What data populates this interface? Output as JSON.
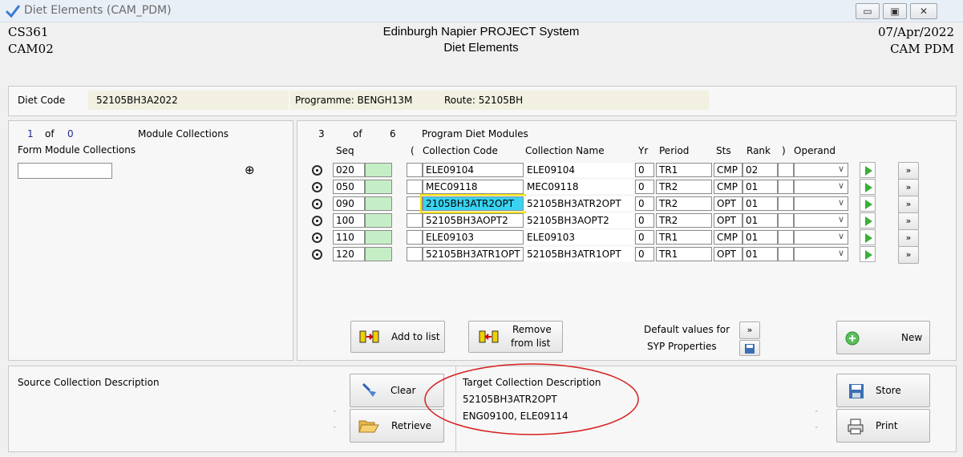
{
  "window": {
    "title": "Diet Elements (CAM_PDM)",
    "btn_min": "▭",
    "btn_max": "▣",
    "btn_close": "✕"
  },
  "header": {
    "left1": "CS361",
    "left2": "CAM02",
    "center1": "Edinburgh Napier PROJECT System",
    "center2": "Diet Elements",
    "right1": "07/Apr/2022",
    "right2": "CAM  PDM"
  },
  "diet": {
    "code_label": "Diet Code",
    "code_value": "52105BH3A2022",
    "programme": "Programme: BENGH13M",
    "route": "Route: 52105BH"
  },
  "left_panel": {
    "count": "1",
    "of": "of",
    "total": "0",
    "title": "Module Collections",
    "form_label": "Form Module Collections",
    "input_value": "",
    "target_icon": "⊕"
  },
  "grid": {
    "count": "3",
    "of": "of",
    "total": "6",
    "title": "Program Diet Modules",
    "headers": {
      "seq": "Seq",
      "lparen": "(",
      "code": "Collection Code",
      "name": "Collection Name",
      "yr": "Yr",
      "period": "Period",
      "sts": "Sts",
      "rank": "Rank",
      "rparen": ")",
      "operand": "Operand"
    },
    "rows": [
      {
        "seq": "020",
        "code": "ELE09104",
        "name": "ELE09104",
        "yr": "0",
        "period": "TR1",
        "sts": "CMP",
        "rank": "02"
      },
      {
        "seq": "050",
        "code": "MEC09118",
        "name": "MEC09118",
        "yr": "0",
        "period": "TR2",
        "sts": "CMP",
        "rank": "01"
      },
      {
        "seq": "090",
        "code": "2105BH3ATR2OPT",
        "name": "52105BH3ATR2OPT",
        "yr": "0",
        "period": "TR2",
        "sts": "OPT",
        "rank": "01"
      },
      {
        "seq": "100",
        "code": "52105BH3AOPT2",
        "name": "52105BH3AOPT2",
        "yr": "0",
        "period": "TR2",
        "sts": "OPT",
        "rank": "01"
      },
      {
        "seq": "110",
        "code": "ELE09103",
        "name": "ELE09103",
        "yr": "0",
        "period": "TR1",
        "sts": "CMP",
        "rank": "01"
      },
      {
        "seq": "120",
        "code": "52105BH3ATR1OPT",
        "name": "52105BH3ATR1OPT",
        "yr": "0",
        "period": "TR1",
        "sts": "OPT",
        "rank": "01"
      }
    ],
    "row_go": "»"
  },
  "actions": {
    "add": "Add to list",
    "remove1": "Remove",
    "remove2": "from list",
    "default1": "Default values for",
    "default2": "SYP Properties",
    "default_go": "»",
    "new": "New"
  },
  "bottom": {
    "source_title": "Source Collection Description",
    "clear": "Clear",
    "retrieve": "Retrieve",
    "target_title": "Target Collection Description",
    "target_line1": "52105BH3ATR2OPT",
    "target_line2": "ENG09100, ELE09114",
    "store": "Store",
    "print": "Print"
  },
  "colors": {
    "highlight_fill": "#38d3f0",
    "highlight_border": "#f2e400",
    "annotation": "#d61f1f",
    "green": "#c6eec6"
  }
}
